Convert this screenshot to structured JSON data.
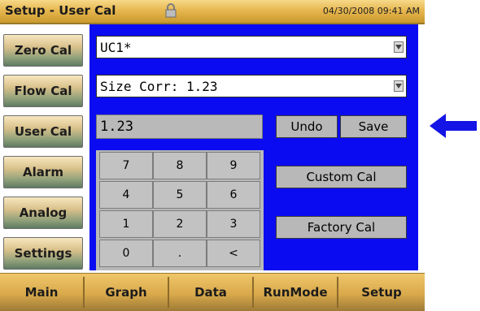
{
  "window": {
    "title": "Setup - User Cal",
    "datetime": "04/30/2008 09:41 AM"
  },
  "left_nav": {
    "items": [
      {
        "label": "Zero Cal"
      },
      {
        "label": "Flow Cal"
      },
      {
        "label": "User Cal"
      },
      {
        "label": "Alarm"
      },
      {
        "label": "Analog"
      },
      {
        "label": "Settings"
      }
    ]
  },
  "main": {
    "cal_select": {
      "value": "UC1*"
    },
    "size_corr_select": {
      "value": "Size Corr: 1.23"
    },
    "entry_value": "1.23",
    "undo_label": "Undo",
    "save_label": "Save",
    "custom_cal_label": "Custom Cal",
    "factory_cal_label": "Factory Cal",
    "keypad": {
      "keys": [
        "7",
        "8",
        "9",
        "4",
        "5",
        "6",
        "1",
        "2",
        "3",
        "0",
        ".",
        "<"
      ]
    }
  },
  "bottom_tabs": {
    "items": [
      {
        "label": "Main"
      },
      {
        "label": "Graph"
      },
      {
        "label": "Data"
      },
      {
        "label": "RunMode"
      },
      {
        "label": "Setup"
      }
    ]
  },
  "colors": {
    "panel_blue": "#0B0BF2",
    "title_gold": "#E7B750",
    "arrow_blue": "#1414E6"
  },
  "icons": {
    "lock": "lock-icon",
    "dropdown": "chevron-down-icon",
    "callout": "left-arrow-icon"
  }
}
